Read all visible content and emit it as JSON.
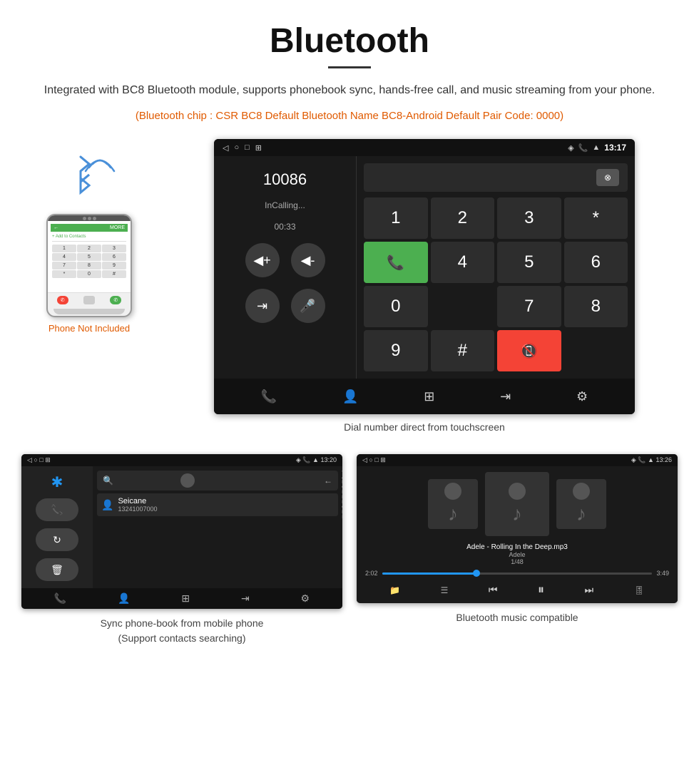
{
  "header": {
    "title": "Bluetooth",
    "underline": true,
    "description": "Integrated with BC8 Bluetooth module, supports phonebook sync, hands-free call, and music streaming from your phone.",
    "info_text": "(Bluetooth chip : CSR BC8    Default Bluetooth Name BC8-Android    Default Pair Code: 0000)"
  },
  "phone_section": {
    "not_included": "Phone Not Included"
  },
  "dial_screen": {
    "status_time": "13:17",
    "dial_number": "10086",
    "call_status": "InCalling...",
    "call_duration": "00:33",
    "keypad": [
      "1",
      "2",
      "3",
      "*",
      "",
      "4",
      "5",
      "6",
      "0",
      "",
      "7",
      "8",
      "9",
      "#",
      ""
    ],
    "caption": "Dial number direct from touchscreen"
  },
  "phonebook_screen": {
    "status_time": "13:20",
    "contact_name": "Seicane",
    "contact_number": "13241007000",
    "alphabet": [
      "*",
      "A",
      "B",
      "C",
      "D",
      "E",
      "F",
      "G",
      "H",
      "I"
    ],
    "caption_line1": "Sync phone-book from mobile phone",
    "caption_line2": "(Support contacts searching)"
  },
  "music_screen": {
    "status_time": "13:26",
    "song_title": "Adele - Rolling In the Deep.mp3",
    "artist": "Adele",
    "track_count": "1/48",
    "time_current": "2:02",
    "time_total": "3:49",
    "progress_percent": 35,
    "caption": "Bluetooth music compatible"
  }
}
